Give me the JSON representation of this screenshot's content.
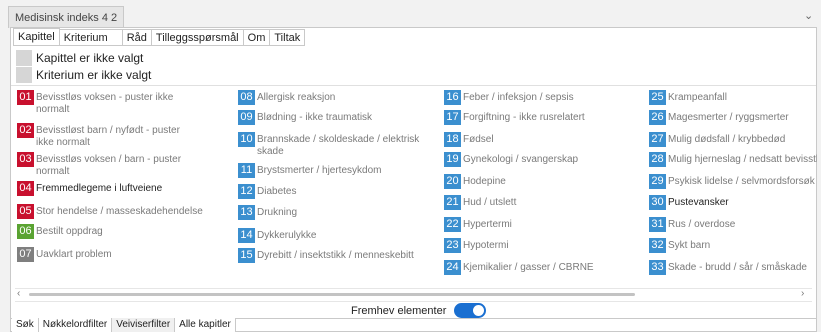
{
  "window": {
    "title": "Medisinsk indeks 4 2"
  },
  "top_tabs": [
    "Kapittel",
    "Kriterium",
    "Råd",
    "Tilleggsspørsmål",
    "Om",
    "Tiltak"
  ],
  "status": {
    "kapittel": "Kapittel er ikke valgt",
    "kriterium": "Kriterium er ikke valgt"
  },
  "colors": {
    "red": "#c8102e",
    "green": "#5aa332",
    "gray": "#7f7f7f",
    "blue": "#3b8fcf",
    "toggle_on": "#1a6fd1"
  },
  "items": [
    {
      "num": "01",
      "label": "Bevisstløs voksen - puster ikke\nnormalt",
      "color": "red",
      "dim": true
    },
    {
      "num": "02",
      "label": "Bevisstløst barn / nyfødt - puster\nikke normalt",
      "color": "red",
      "dim": true
    },
    {
      "num": "03",
      "label": "Bevisstløs voksen / barn - puster\nnormalt",
      "color": "red",
      "dim": true
    },
    {
      "num": "04",
      "label": "Fremmedlegeme i luftveiene",
      "color": "red",
      "dim": false
    },
    {
      "num": "05",
      "label": "Stor hendelse / masseskadehendelse",
      "color": "red",
      "dim": true
    },
    {
      "num": "06",
      "label": "Bestilt oppdrag",
      "color": "green",
      "dim": true
    },
    {
      "num": "07",
      "label": "Uavklart problem",
      "color": "gray",
      "dim": true
    },
    {
      "num": "08",
      "label": "Allergisk reaksjon",
      "color": "blue",
      "dim": true
    },
    {
      "num": "09",
      "label": "Blødning - ikke traumatisk",
      "color": "blue",
      "dim": true
    },
    {
      "num": "10",
      "label": "Brannskade / skoldeskade / elektrisk\nskade",
      "color": "blue",
      "dim": true
    },
    {
      "num": "11",
      "label": "Brystsmerter / hjertesykdom",
      "color": "blue",
      "dim": true
    },
    {
      "num": "12",
      "label": "Diabetes",
      "color": "blue",
      "dim": true
    },
    {
      "num": "13",
      "label": "Drukning",
      "color": "blue",
      "dim": true
    },
    {
      "num": "14",
      "label": "Dykkerulykke",
      "color": "blue",
      "dim": true
    },
    {
      "num": "15",
      "label": "Dyrebitt / insektstikk / menneskebitt",
      "color": "blue",
      "dim": true
    },
    {
      "num": "16",
      "label": "Feber / infeksjon / sepsis",
      "color": "blue",
      "dim": true
    },
    {
      "num": "17",
      "label": "Forgiftning - ikke rusrelatert",
      "color": "blue",
      "dim": true
    },
    {
      "num": "18",
      "label": "Fødsel",
      "color": "blue",
      "dim": true
    },
    {
      "num": "19",
      "label": "Gynekologi / svangerskap",
      "color": "blue",
      "dim": true
    },
    {
      "num": "20",
      "label": "Hodepine",
      "color": "blue",
      "dim": true
    },
    {
      "num": "21",
      "label": "Hud / utslett",
      "color": "blue",
      "dim": true
    },
    {
      "num": "22",
      "label": "Hypertermi",
      "color": "blue",
      "dim": true
    },
    {
      "num": "23",
      "label": "Hypotermi",
      "color": "blue",
      "dim": true
    },
    {
      "num": "24",
      "label": "Kjemikalier / gasser / CBRNE",
      "color": "blue",
      "dim": true
    },
    {
      "num": "25",
      "label": "Krampeanfall",
      "color": "blue",
      "dim": true
    },
    {
      "num": "26",
      "label": "Magesmerter / ryggsmerter",
      "color": "blue",
      "dim": true
    },
    {
      "num": "27",
      "label": "Mulig dødsfall / krybbedød",
      "color": "blue",
      "dim": true
    },
    {
      "num": "28",
      "label": "Mulig hjerneslag / nedsatt bevisstl",
      "color": "blue",
      "dim": true
    },
    {
      "num": "29",
      "label": "Psykisk lidelse / selvmordsforsøk",
      "color": "blue",
      "dim": true
    },
    {
      "num": "30",
      "label": "Pustevansker",
      "color": "blue",
      "dim": false
    },
    {
      "num": "31",
      "label": "Rus / overdose",
      "color": "blue",
      "dim": true
    },
    {
      "num": "32",
      "label": "Sykt barn",
      "color": "blue",
      "dim": true
    },
    {
      "num": "33",
      "label": "Skade - brudd / sår / småskade",
      "color": "blue",
      "dim": true
    }
  ],
  "toggle": {
    "label": "Fremhev elementer",
    "on": true
  },
  "bottom_tabs": [
    "Søk",
    "Nøkkelordfilter",
    "Veiviserfilter",
    "Alle kapitler"
  ],
  "bottom_active_tab": "Veiviserfilter"
}
